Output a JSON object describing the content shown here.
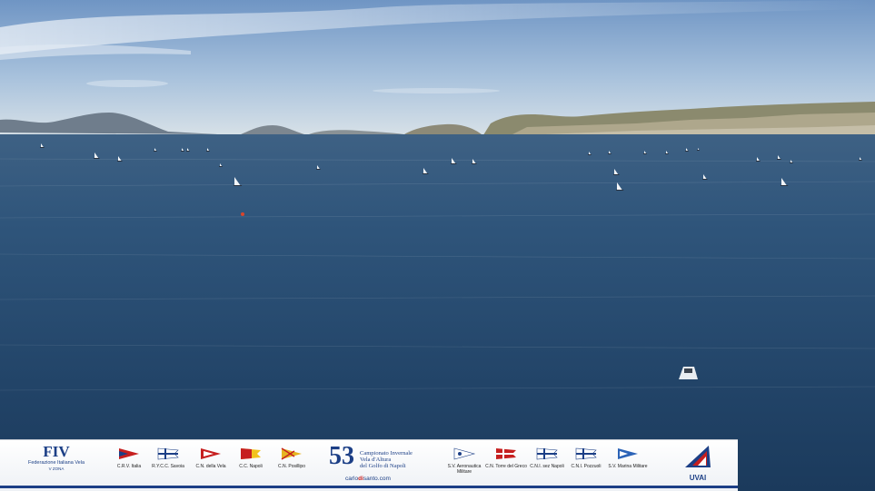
{
  "banner": {
    "fiv": {
      "mark": "FIV",
      "sub": "Federazione Italiana Vela",
      "zone": "V ZONA"
    },
    "clubs_left": [
      {
        "label": "C.R.V. Italia",
        "flag": "red-pennant"
      },
      {
        "label": "R.Y.C.C. Savoia",
        "flag": "blue-cross-burgee"
      },
      {
        "label": "C.N. della Vela",
        "flag": "red-white-pennant"
      },
      {
        "label": "C.C. Napoli",
        "flag": "yellow-red-burgee"
      },
      {
        "label": "C.N. Posillipo",
        "flag": "gold-cross-pennant"
      }
    ],
    "center": {
      "number": "53",
      "line1": "Campionato Invernale",
      "line2": "Vela d'Altura",
      "line3": "del Golfo di Napoli",
      "credit_a": "carlo",
      "credit_b": "di",
      "credit_c": "santo.com"
    },
    "clubs_right": [
      {
        "label": "S.V. Aeronautica Militare",
        "flag": "white-pennant"
      },
      {
        "label": "C.N. Torre del Greco",
        "flag": "red-cross-burgee"
      },
      {
        "label": "C.N.I. sez Napoli",
        "flag": "blue-cross-burgee"
      },
      {
        "label": "C.N.I. Pozzuoli",
        "flag": "blue-cross-burgee"
      },
      {
        "label": "S.V. Marina Militare",
        "flag": "blue-pennant"
      }
    ],
    "uvai": {
      "text": "UVAI"
    }
  },
  "colors": {
    "navy": "#1c3f86",
    "red": "#c61f1f",
    "sea": "#23486e",
    "sky": "#a9c4df"
  }
}
